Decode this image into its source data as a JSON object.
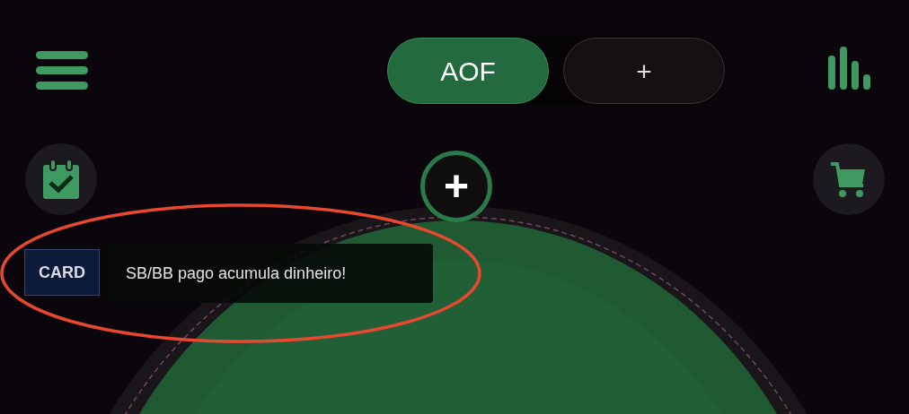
{
  "tabs": [
    {
      "label": "AOF",
      "selected": true
    },
    {
      "label": "+",
      "selected": false
    }
  ],
  "add_seat_button": {
    "label": "+"
  },
  "toast": {
    "badge": "CARD",
    "message": "SB/BB pago acumula dinheiro!"
  }
}
